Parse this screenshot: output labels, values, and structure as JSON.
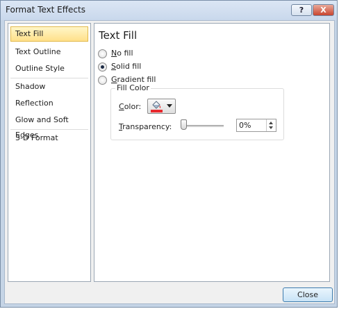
{
  "window": {
    "title": "Format Text Effects",
    "help_label": "?",
    "close_label": "X"
  },
  "nav": {
    "items": [
      {
        "label": "Text Fill"
      },
      {
        "label": "Text Outline"
      },
      {
        "label": "Outline Style"
      },
      {
        "label": "Shadow"
      },
      {
        "label": "Reflection"
      },
      {
        "label": "Glow and Soft Edges"
      },
      {
        "label": "3-D Format"
      }
    ],
    "selected": "Text Fill"
  },
  "panel": {
    "title": "Text Fill",
    "options": [
      {
        "mnemonic": "N",
        "rest": "o fill",
        "checked": false
      },
      {
        "mnemonic": "S",
        "rest": "olid fill",
        "checked": true
      },
      {
        "mnemonic": "G",
        "rest": "radient fill",
        "checked": false
      }
    ],
    "fill_color": {
      "group_title": "Fill Color",
      "color_label_mnemonic": "C",
      "color_label_rest": "olor:",
      "swatch_color": "#e8282d",
      "transparency_label_mnemonic": "T",
      "transparency_label_rest": "ransparency:",
      "transparency_value": "0%"
    }
  },
  "footer": {
    "close_button": "Close"
  },
  "icons": [
    "help-icon",
    "close-icon",
    "paint-bucket-icon",
    "dropdown-arrow-icon",
    "spin-up-icon",
    "spin-down-icon"
  ]
}
